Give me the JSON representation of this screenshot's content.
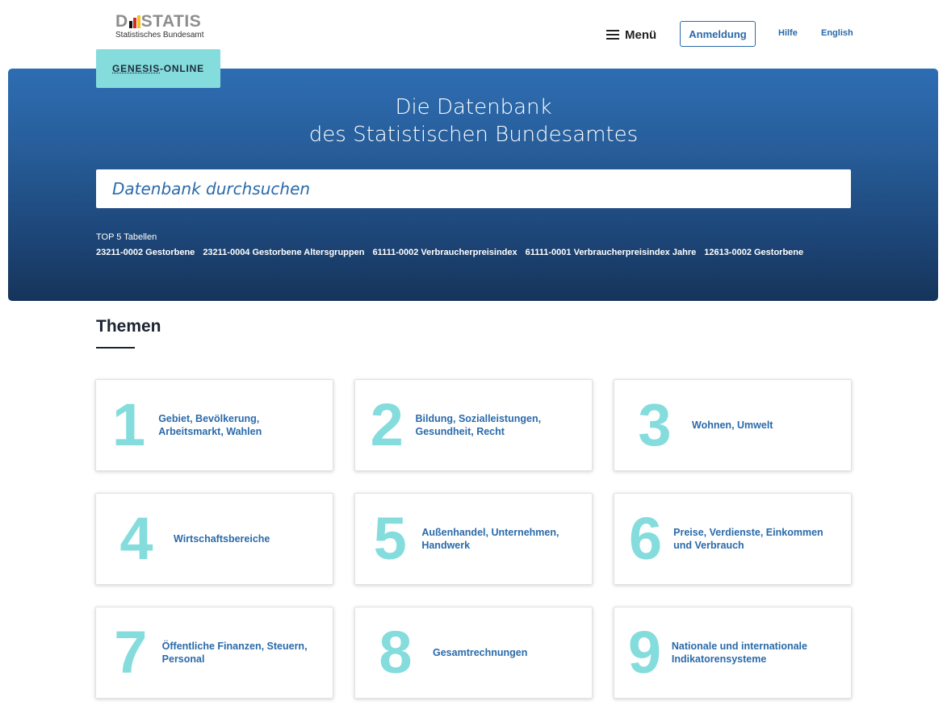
{
  "header": {
    "logo_word_left": "D",
    "logo_word_right": "STATIS",
    "logo_subtitle": "Statistisches Bundesamt",
    "menu_label": "Menü",
    "login_label": "Anmeldung",
    "help_label": "Hilfe",
    "language_label": "English"
  },
  "hero": {
    "tab_prefix": "GENESIS",
    "tab_suffix": "-ONLINE",
    "title_line1": "Die Datenbank",
    "title_line2": "des Statistischen Bundesamtes",
    "search_placeholder": "Datenbank durchsuchen",
    "top5_label": "TOP 5 Tabellen",
    "top5_links": [
      "23211-0002 Gestorbene",
      "23211-0004 Gestorbene Altersgruppen",
      "61111-0002 Verbraucherpreisindex",
      "61111-0001 Verbraucherpreisindex Jahre",
      "12613-0002 Gestorbene"
    ]
  },
  "themen": {
    "heading": "Themen",
    "tiles": [
      {
        "number": "1",
        "label": "Gebiet, Bevölkerung, Arbeitsmarkt, Wahlen"
      },
      {
        "number": "2",
        "label": "Bildung, Sozialleistungen, Gesundheit, Recht"
      },
      {
        "number": "3",
        "label": "Wohnen, Umwelt"
      },
      {
        "number": "4",
        "label": "Wirtschaftsbereiche"
      },
      {
        "number": "5",
        "label": "Außenhandel, Unternehmen, Handwerk"
      },
      {
        "number": "6",
        "label": "Preise, Verdienste, Einkommen und Verbrauch"
      },
      {
        "number": "7",
        "label": "Öffentliche Finanzen, Steuern, Personal"
      },
      {
        "number": "8",
        "label": "Gesamtrechnungen"
      },
      {
        "number": "9",
        "label": "Nationale und internationale Indikatorensysteme"
      }
    ]
  },
  "colors": {
    "accent_teal": "#85dcdd",
    "link_blue": "#2a6aaa",
    "hero_top": "#2e6db3",
    "hero_bottom": "#16345a"
  }
}
